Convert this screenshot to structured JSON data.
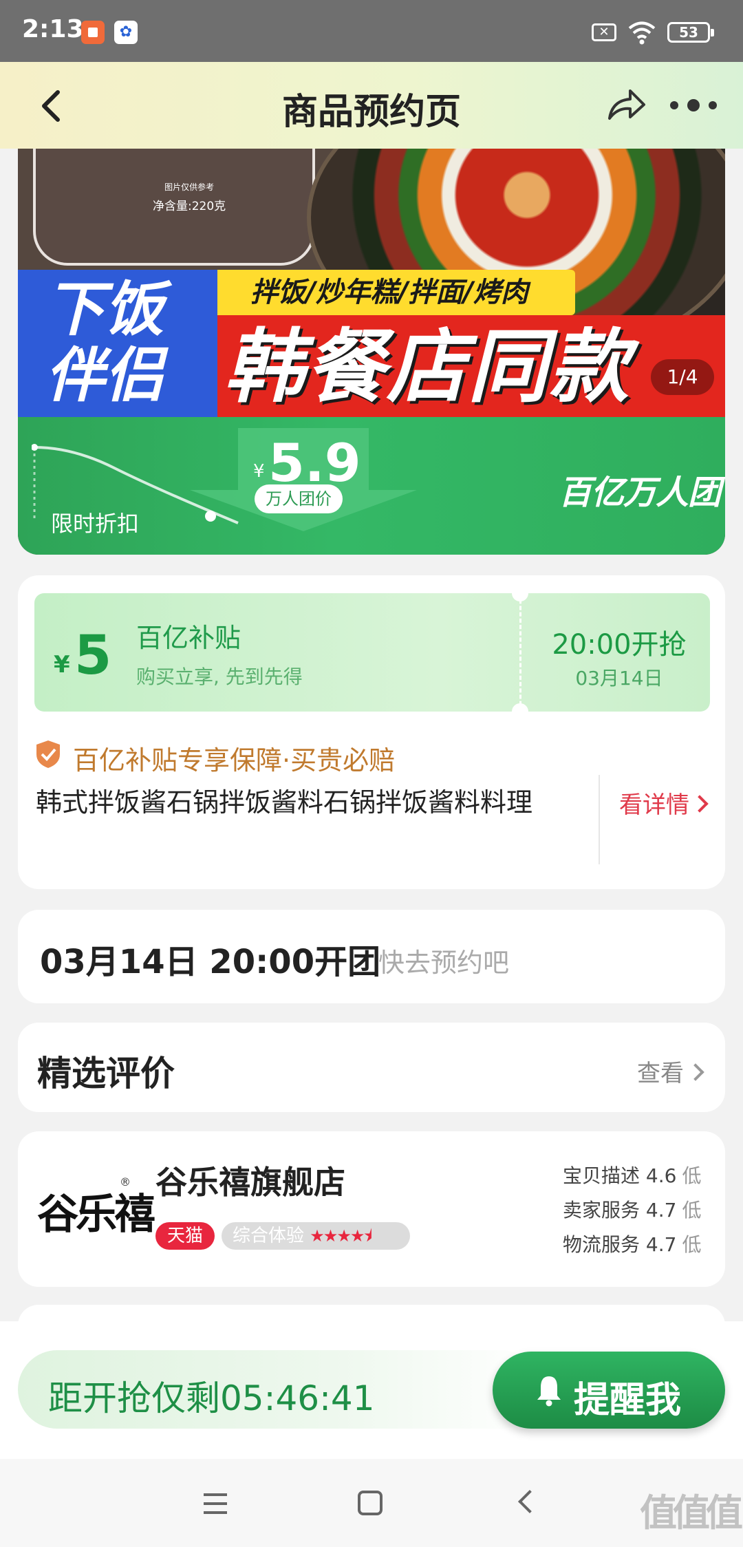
{
  "status_bar": {
    "time": "2:13",
    "battery": "53"
  },
  "header": {
    "title": "商品预约页"
  },
  "banner": {
    "net_weight": "净含量:220克",
    "ref_note": "图片仅供参考",
    "tags": "拌饭/炒年糕/拌面/烤肉",
    "left_slogan_1": "下饭",
    "left_slogan_2": "伴侣",
    "big_slogan": "韩餐店同款",
    "counter": "1/4",
    "price_currency": "¥",
    "price": "5.9",
    "price_label": "万人团价",
    "discount_label": "限时折扣",
    "brand": "百亿万人团"
  },
  "coupon": {
    "currency": "¥",
    "amount": "5",
    "title": "百亿补贴",
    "desc": "购买立享, 先到先得",
    "start_time": "20:00开抢",
    "start_date": "03月14日"
  },
  "guarantee": {
    "text": "百亿补贴专享保障·买贵必赔"
  },
  "product": {
    "name": "韩式拌饭酱石锅拌饭酱料石锅拌饭酱料料理",
    "detail_link": "看详情"
  },
  "open_info": {
    "time": "03月14日 20:00开团",
    "hint": "快去预约吧"
  },
  "reviews": {
    "title": "精选评价",
    "view_label": "查看"
  },
  "store": {
    "logo_text": "谷乐禧",
    "logo_reg": "®",
    "name": "谷乐禧旗舰店",
    "platform_badge": "天猫",
    "experience_label": "综合体验",
    "experience_stars": 4.5,
    "metrics": [
      {
        "label": "宝贝描述",
        "score": "4.6",
        "level": "低"
      },
      {
        "label": "卖家服务",
        "score": "4.7",
        "level": "低"
      },
      {
        "label": "物流服务",
        "score": "4.7",
        "level": "低"
      }
    ]
  },
  "action_bar": {
    "countdown": "距开抢仅剩05:46:41",
    "remind_label": "提醒我"
  },
  "watermark": "值值值",
  "colors": {
    "brand_green": "#1e8f46",
    "subsidy_red": "#e03a4a",
    "guarantee_orange": "#c07a2e"
  }
}
